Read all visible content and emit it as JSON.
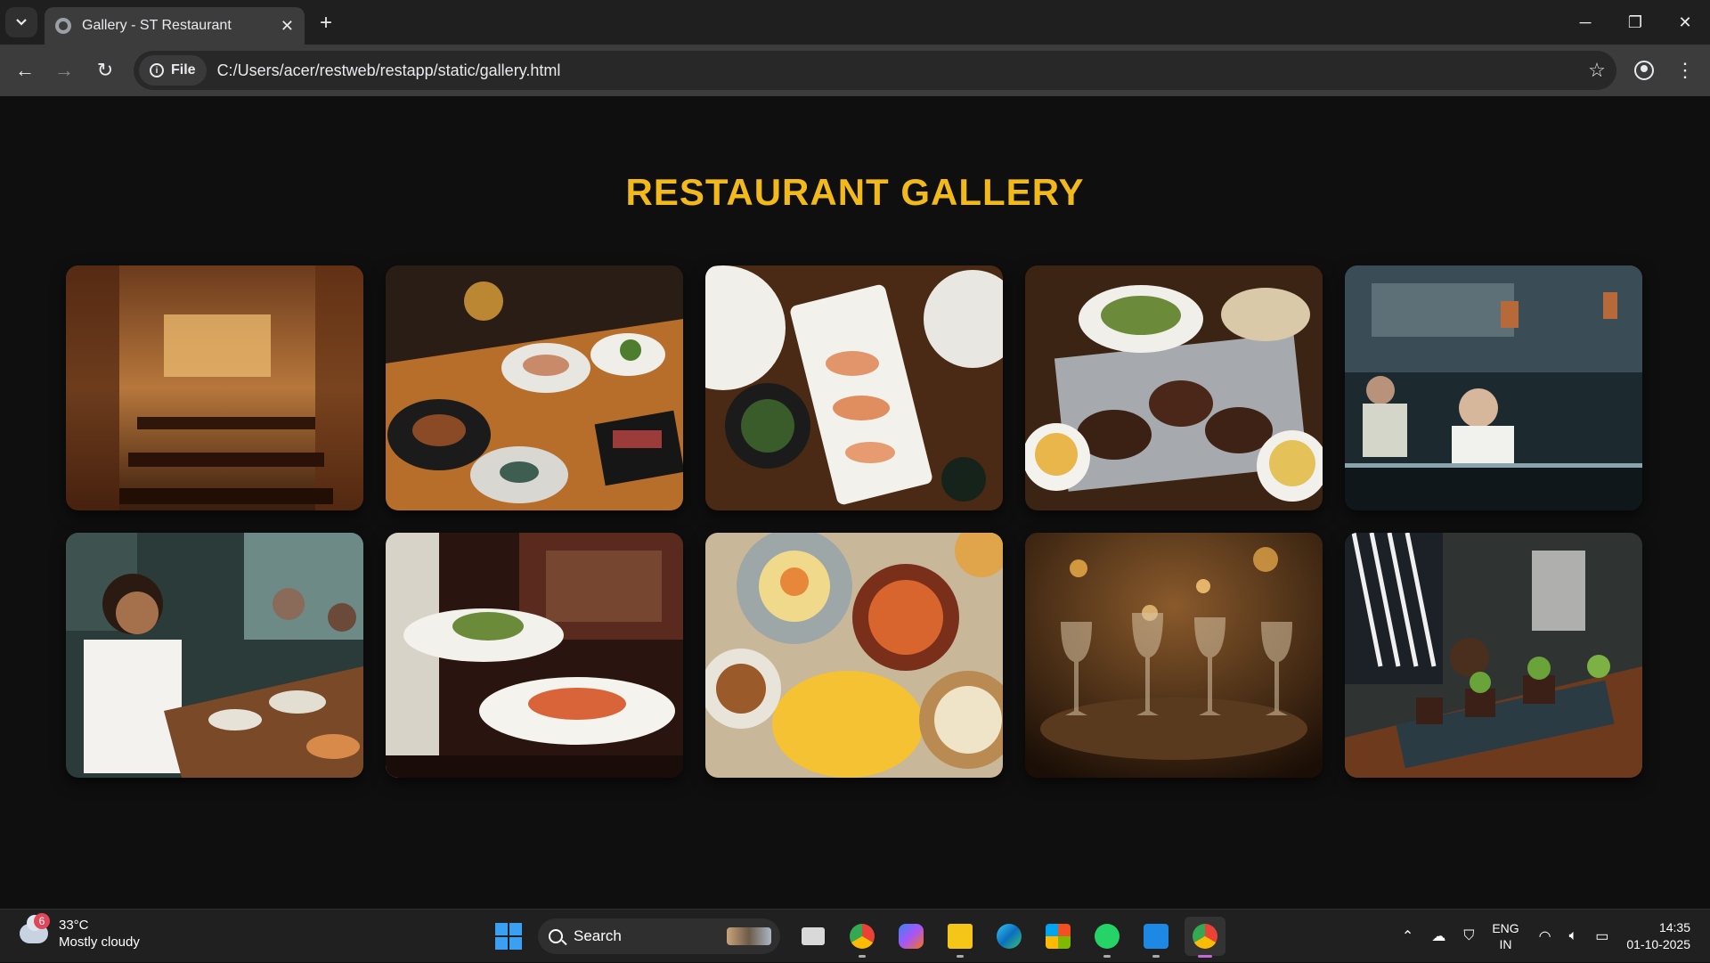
{
  "browser": {
    "tab_title": "Gallery - ST Restaurant",
    "tab_close": "✕",
    "new_tab": "+",
    "window": {
      "minimize": "─",
      "restore": "❐",
      "close": "✕"
    },
    "nav": {
      "back": "←",
      "forward": "→",
      "reload": "↻"
    },
    "site_chip": "File",
    "url": "C:/Users/acer/restweb/restapp/static/gallery.html",
    "bookmark": "☆",
    "menu": "⋮"
  },
  "page": {
    "heading": "RESTAURANT GALLERY",
    "accent_color": "#f2b91b",
    "photos": [
      {
        "name": "restaurant-interior",
        "theme": "warm wooden dining room"
      },
      {
        "name": "table-spread",
        "theme": "steaks, cocktails and platters"
      },
      {
        "name": "shrimp-platter",
        "theme": "shrimp and seafood plates"
      },
      {
        "name": "steak-board",
        "theme": "steaks, salad and sides"
      },
      {
        "name": "open-kitchen",
        "theme": "chefs in open kitchen"
      },
      {
        "name": "diners-eating",
        "theme": "guests eating at table"
      },
      {
        "name": "plates-served",
        "theme": "waiter serving plates"
      },
      {
        "name": "indian-feast",
        "theme": "curries and naan"
      },
      {
        "name": "wine-glasses",
        "theme": "candle-lit table with glasses"
      },
      {
        "name": "chef-plating",
        "theme": "chef plating dishes"
      }
    ]
  },
  "taskbar": {
    "weather_badge": "6",
    "temperature": "33°C",
    "condition": "Mostly cloudy",
    "search_label": "Search",
    "apps": [
      "task-view",
      "chrome",
      "copilot",
      "file-explorer",
      "edge",
      "microsoft-store",
      "whatsapp",
      "vscode",
      "chrome-active"
    ],
    "tray_chevron": "⌃",
    "lang_top": "ENG",
    "lang_bottom": "IN",
    "time": "14:35",
    "date": "01-10-2025"
  }
}
